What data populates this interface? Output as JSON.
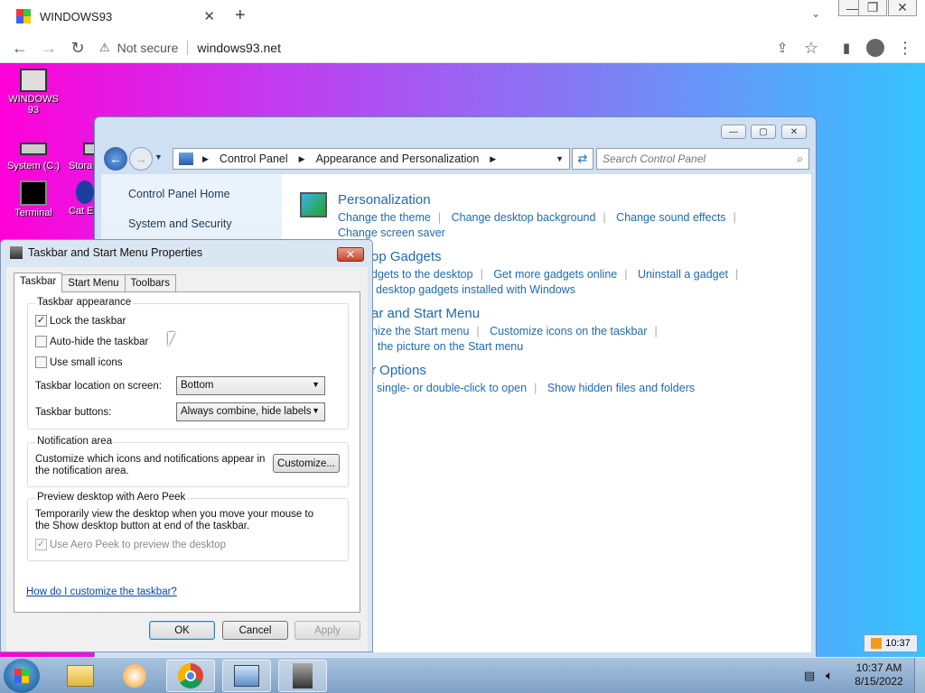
{
  "browser": {
    "tab_title": "WINDOWS93",
    "tab_close": "✕",
    "new_tab": "+",
    "security_label": "Not secure",
    "url": "windows93.net"
  },
  "desktop": {
    "icons": [
      {
        "label": "WINDOWS 93"
      },
      {
        "label": "System (C:)"
      },
      {
        "label": "Stora"
      },
      {
        "label": "Terminal"
      },
      {
        "label": "Cat E"
      }
    ],
    "clock_badge": "10:37"
  },
  "control_panel": {
    "breadcrumb": [
      "Control Panel",
      "Appearance and Personalization"
    ],
    "search_placeholder": "Search Control Panel",
    "left_links": [
      "Control Panel Home",
      "System and Security"
    ],
    "categories": [
      {
        "title": "Personalization",
        "links": [
          "Change the theme",
          "Change desktop background",
          "Change sound effects",
          "Change screen saver"
        ]
      },
      {
        "title": "op Gadgets",
        "links": [
          "dgets to the desktop",
          "Get more gadgets online",
          "Uninstall a gadget",
          "desktop gadgets installed with Windows"
        ]
      },
      {
        "title": "ar and Start Menu",
        "links": [
          "nize the Start menu",
          "Customize icons on the taskbar",
          "the picture on the Start menu"
        ]
      },
      {
        "title": "r Options",
        "links": [
          "single- or double-click to open",
          "Show hidden files and folders"
        ]
      }
    ]
  },
  "dialog": {
    "title": "Taskbar and Start Menu Properties",
    "tabs": [
      "Taskbar",
      "Start Menu",
      "Toolbars"
    ],
    "taskbar_appearance": {
      "label": "Taskbar appearance",
      "lock": {
        "label": "Lock the taskbar",
        "checked": true
      },
      "autohide": {
        "label": "Auto-hide the taskbar",
        "checked": false
      },
      "small_icons": {
        "label": "Use small icons",
        "checked": false
      },
      "location_label": "Taskbar location on screen:",
      "location_value": "Bottom",
      "buttons_label": "Taskbar buttons:",
      "buttons_value": "Always combine, hide labels"
    },
    "notification_area": {
      "label": "Notification area",
      "text": "Customize which icons and notifications appear in the notification area.",
      "customize_button": "Customize..."
    },
    "aero_peek": {
      "label": "Preview desktop with Aero Peek",
      "text": "Temporarily view the desktop when you move your mouse to the Show desktop button at end of the taskbar.",
      "checkbox": {
        "label": "Use Aero Peek to preview the desktop",
        "checked": true,
        "disabled": true
      }
    },
    "help_link": "How do I customize the taskbar?",
    "ok": "OK",
    "cancel": "Cancel",
    "apply": "Apply"
  },
  "taskbar": {
    "time": "10:37 AM",
    "date": "8/15/2022"
  }
}
